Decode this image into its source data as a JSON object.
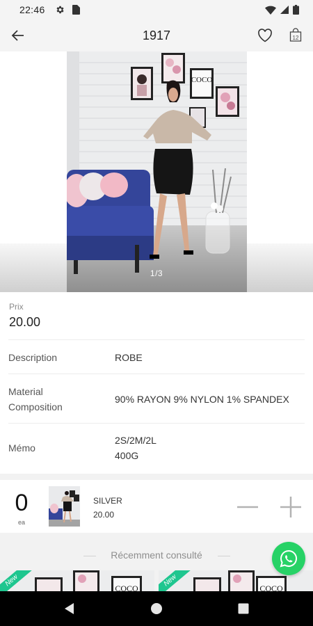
{
  "status_bar": {
    "time": "22:46",
    "icons": [
      "settings-icon",
      "sim-card-icon",
      "wifi-icon",
      "signal-icon",
      "battery-icon"
    ]
  },
  "app_bar": {
    "title": "1917",
    "cart_count": "12",
    "icons": [
      "back-arrow-icon",
      "heart-icon",
      "shopping-bag-icon"
    ]
  },
  "gallery": {
    "indicator": "1/3",
    "poster_text": "COCO"
  },
  "price": {
    "label": "Prix",
    "value": "20.00"
  },
  "specs": [
    {
      "key": "Description",
      "value": "ROBE"
    },
    {
      "key_line1": "Material",
      "key_line2": "Composition",
      "value": "90% RAYON 9% NYLON 1% SPANDEX"
    },
    {
      "key": "Mémo",
      "value_line1": "2S/2M/2L",
      "value_line2": "400G"
    }
  ],
  "variant": {
    "quantity": "0",
    "unit": "ea",
    "color": "SILVER",
    "price": "20.00",
    "icons": [
      "minus-icon",
      "plus-icon"
    ]
  },
  "recent": {
    "title": "Récemment consulté",
    "badges": [
      "New",
      "New"
    ]
  },
  "colors": {
    "whatsapp": "#27d266",
    "new_badge": "#1ec68f"
  }
}
